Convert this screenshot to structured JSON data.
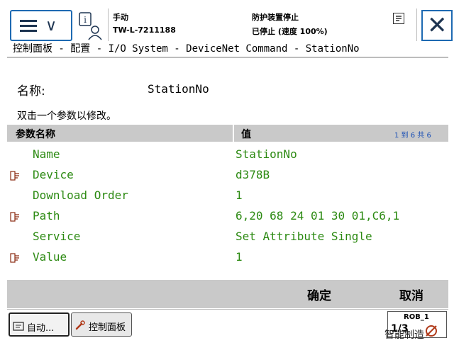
{
  "header": {
    "mode": "手动",
    "controller": "TW-L-7211188",
    "safety_status": "防护装置停止",
    "run_status": "已停止 (速度 100%)"
  },
  "breadcrumb": "控制面板 - 配置 - I/O System - DeviceNet Command - StationNo",
  "name": {
    "label": "名称:",
    "value": "StationNo"
  },
  "hint": "双击一个参数以修改。",
  "table": {
    "header_name": "参数名称",
    "header_value": "值",
    "count": "1 到 6 共 6",
    "rows": [
      {
        "name": "Name",
        "value": "StationNo",
        "icon": false
      },
      {
        "name": "Device",
        "value": "d378B",
        "icon": true
      },
      {
        "name": "Download Order",
        "value": "1",
        "icon": false
      },
      {
        "name": "Path",
        "value": "6,20 68 24 01 30 01,C6,1",
        "icon": true
      },
      {
        "name": "Service",
        "value": "Set Attribute Single",
        "icon": false
      },
      {
        "name": "Value",
        "value": "1",
        "icon": true
      }
    ]
  },
  "actions": {
    "ok": "确定",
    "cancel": "取消"
  },
  "taskbar": {
    "tasks": [
      {
        "label": "自动...",
        "icon": "auto-icon"
      },
      {
        "label": "控制面板",
        "icon": "wrench-icon"
      }
    ],
    "robot": {
      "name": "ROB_1",
      "fraction": "1/3"
    }
  },
  "watermark": "智能制造"
}
